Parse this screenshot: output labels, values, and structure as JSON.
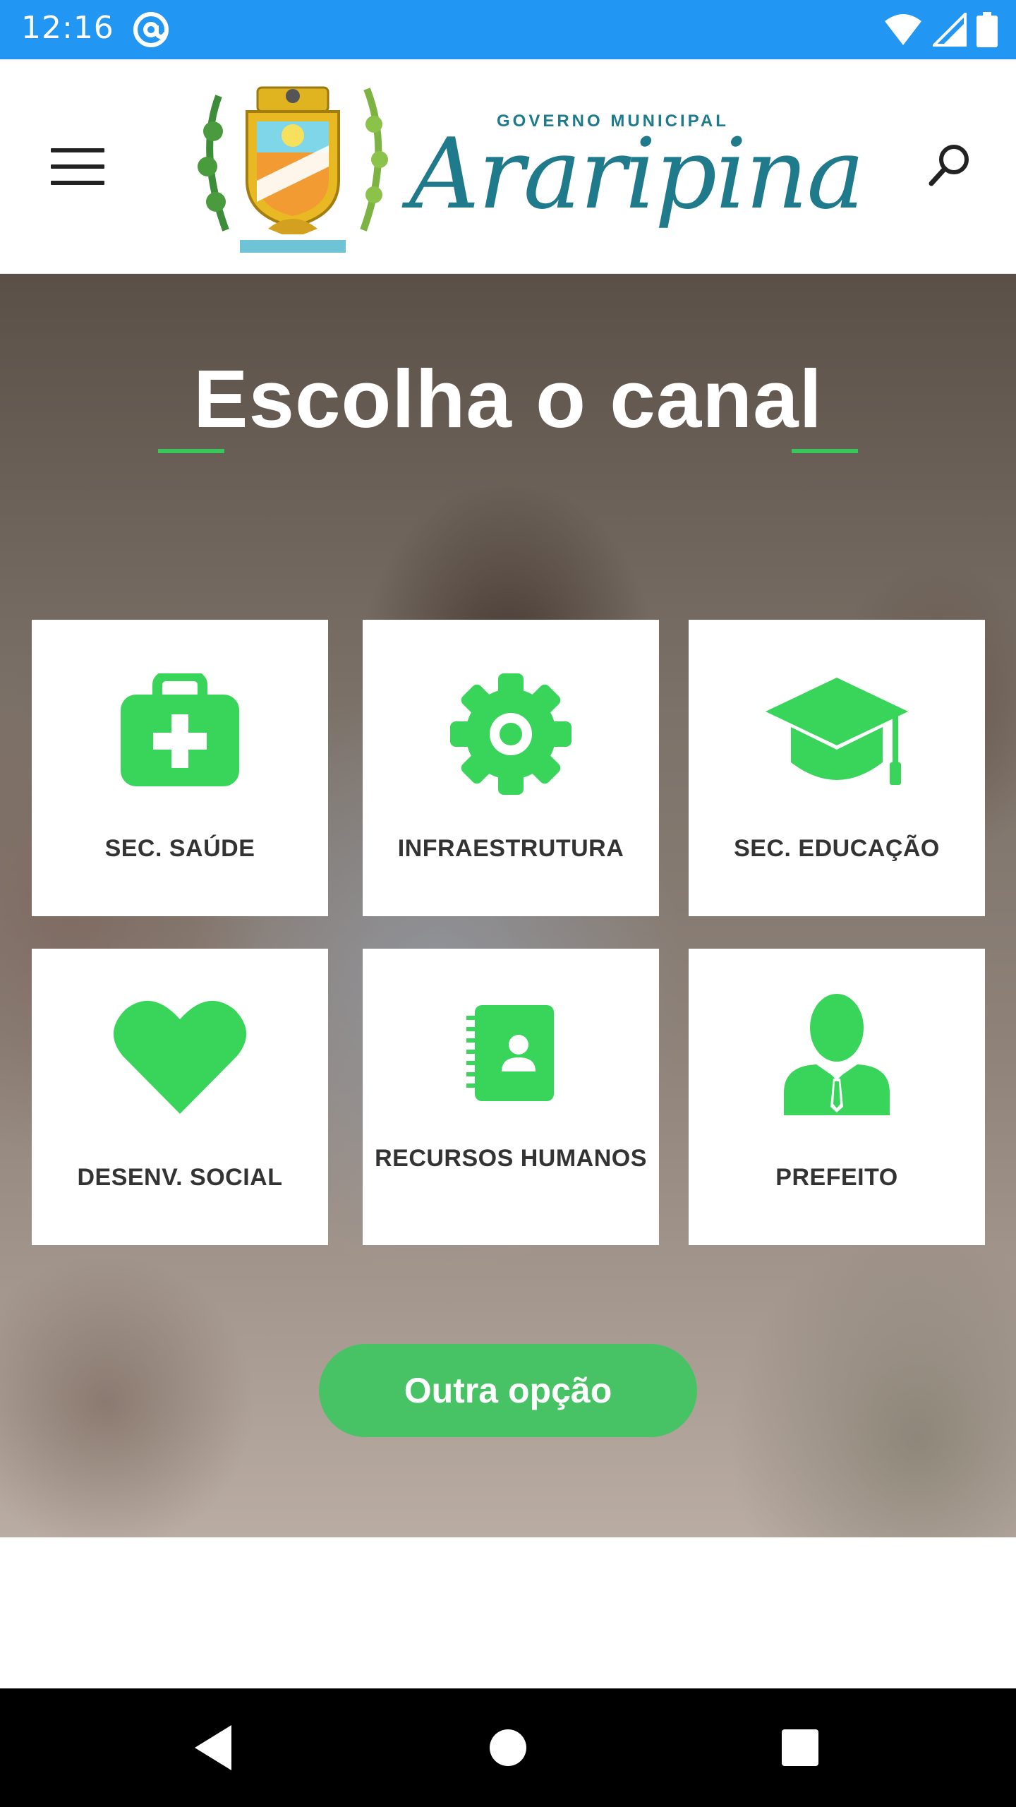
{
  "status_bar": {
    "time": "12:16",
    "icons": [
      "at-sign-icon",
      "wifi-icon",
      "signal-icon",
      "battery-icon"
    ],
    "color": "#2196f3"
  },
  "header": {
    "logo_superscript": "GOVERNO MUNICIPAL",
    "logo_title": "Araripina",
    "menu_icon": "hamburger-menu-icon",
    "search_icon": "search-icon"
  },
  "hero": {
    "title": "Escolha o canal",
    "accent_color": "#39c65a",
    "cards": [
      {
        "label": "SEC. SAÚDE",
        "icon": "medical-kit-icon"
      },
      {
        "label": "INFRAESTRUTURA",
        "icon": "gear-icon"
      },
      {
        "label": "SEC. EDUCAÇÃO",
        "icon": "graduation-cap-icon"
      },
      {
        "label": "DESENV. SOCIAL",
        "icon": "heart-icon"
      },
      {
        "label": "RECURSOS HUMANOS",
        "icon": "contact-book-icon"
      },
      {
        "label": "PREFEITO",
        "icon": "person-suit-icon"
      }
    ],
    "cta_label": "Outra opção",
    "cta_color": "#47c366"
  },
  "nav_bar": {
    "buttons": [
      "back-icon",
      "home-icon",
      "recents-icon"
    ]
  }
}
